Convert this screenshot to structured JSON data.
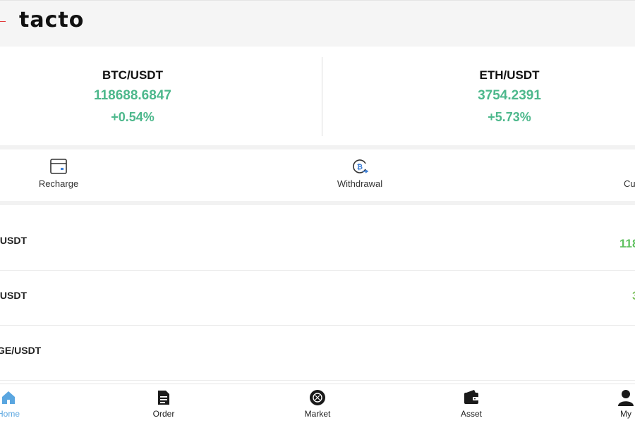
{
  "header": {
    "logo": "tacto"
  },
  "tickers": [
    {
      "pair": "BTC/USDT",
      "price": "118688.6847",
      "change": "+0.54%"
    },
    {
      "pair": "ETH/USDT",
      "price": "3754.2391",
      "change": "+5.73%"
    }
  ],
  "actions": [
    {
      "label": "Recharge",
      "icon": "card-icon"
    },
    {
      "label": "Withdrawal",
      "icon": "bitcoin-withdraw-icon"
    },
    {
      "label": "Cu",
      "icon": "customer-service-icon"
    }
  ],
  "market_list": [
    {
      "symbol": "/USDT",
      "value": "118"
    },
    {
      "symbol": "/USDT",
      "value": "3"
    },
    {
      "symbol": "GE/USDT",
      "value": ""
    }
  ],
  "tabbar": [
    {
      "label": "Home",
      "icon": "home-icon",
      "active": true
    },
    {
      "label": "Order",
      "icon": "document-icon",
      "active": false
    },
    {
      "label": "Market",
      "icon": "market-icon",
      "active": false
    },
    {
      "label": "Asset",
      "icon": "wallet-icon",
      "active": false
    },
    {
      "label": "My",
      "icon": "user-icon",
      "active": false
    }
  ],
  "colors": {
    "positive": "#4db88c",
    "list_positive": "#5fc15f",
    "active_tab": "#5aa6e0",
    "accent": "#e23b3b"
  }
}
